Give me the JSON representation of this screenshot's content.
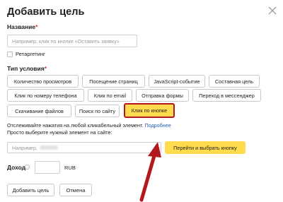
{
  "dialog": {
    "title": "Добавить цель"
  },
  "name_field": {
    "label": "Название",
    "required_mark": "*",
    "placeholder": "Например, клик по кнопке «Оставить заявку»"
  },
  "retargeting": {
    "label": "Ретаргетинг",
    "checked": false
  },
  "condition_type": {
    "label": "Тип условия",
    "required_mark": "*",
    "chips": [
      {
        "label": "Количество просмотров",
        "selected": false
      },
      {
        "label": "Посещение страниц",
        "selected": false
      },
      {
        "label": "JavaScript-событие",
        "selected": false
      },
      {
        "label": "Составная цель",
        "selected": false
      },
      {
        "label": "Клик по номеру телефона",
        "selected": false
      },
      {
        "label": "Клик по email",
        "selected": false
      },
      {
        "label": "Отправка формы",
        "selected": false
      },
      {
        "label": "Переход в мессенджер",
        "selected": false
      },
      {
        "label": "Скачивание файлов",
        "selected": false
      },
      {
        "label": "Поиск по сайту",
        "selected": false
      },
      {
        "label": "Клик по кнопке",
        "selected": true
      }
    ]
  },
  "click_hint": {
    "line1": "Отслеживайте нажатия на любой кликабельный элемент.",
    "more_link": "Подробнее",
    "line2": "Просто выберите нужный элемент на сайте:"
  },
  "site_input": {
    "placeholder": "Например,"
  },
  "pick_button": {
    "label": "Перейти и выбрать кнопку"
  },
  "income": {
    "label": "Доход",
    "value": "",
    "currency": "RUB"
  },
  "footer": {
    "add_label": "Добавить цель",
    "cancel_label": "Отмена"
  },
  "colors": {
    "accent_yellow": "#ffdb4d",
    "highlight_red": "#b3181c",
    "link_blue": "#1a5fb4"
  }
}
